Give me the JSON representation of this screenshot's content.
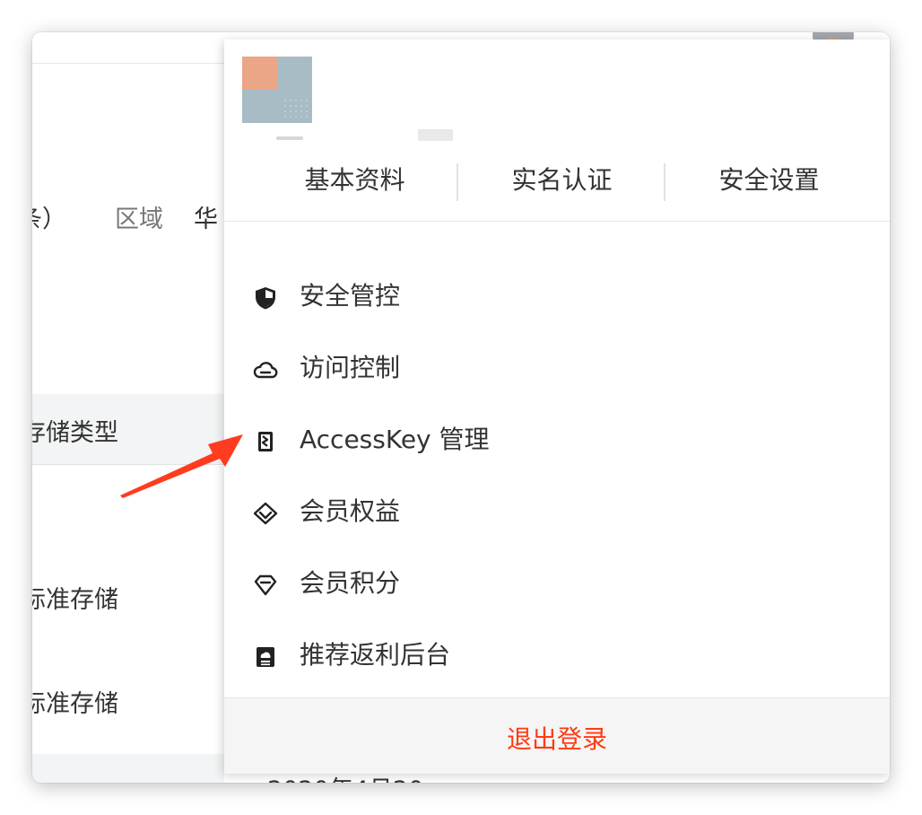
{
  "background_page": {
    "text_fragment": "条）",
    "region_label": "区域",
    "region_value_fragment": "华",
    "column_header_fragment": "存储类型",
    "storage_row_1": "标准存储",
    "storage_row_2": "标准存储",
    "date_fragment": "2020年4月20"
  },
  "account_panel": {
    "tabs": [
      {
        "label": "基本资料"
      },
      {
        "label": "实名认证"
      },
      {
        "label": "安全设置"
      }
    ],
    "menu_items": [
      {
        "label": "安全管控",
        "icon": "shield-icon"
      },
      {
        "label": "访问控制",
        "icon": "cloud-icon"
      },
      {
        "label": "AccessKey 管理",
        "icon": "accesskey-icon"
      },
      {
        "label": "会员权益",
        "icon": "diamond-badge-icon"
      },
      {
        "label": "会员积分",
        "icon": "diamond-icon"
      },
      {
        "label": "推荐返利后台",
        "icon": "rebate-icon"
      }
    ],
    "logout_label": "退出登录"
  },
  "colors": {
    "logout_text": "#ff3b14",
    "annotation_arrow": "#ff3b20",
    "text": "#333333"
  }
}
